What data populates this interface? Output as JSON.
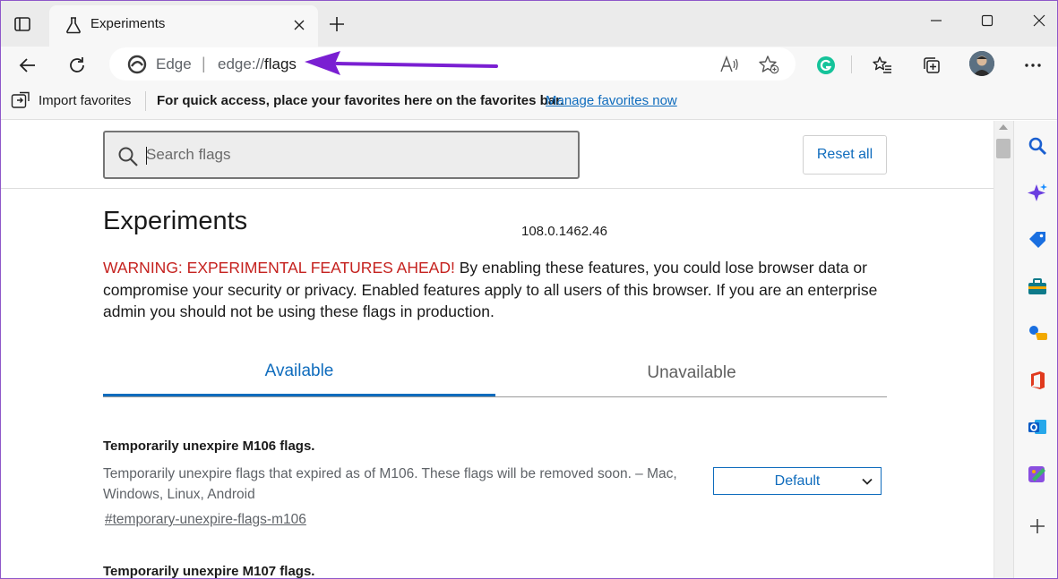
{
  "tab": {
    "title": "Experiments"
  },
  "address": {
    "site_name": "Edge",
    "separator": "|",
    "url_prefix": "edge://",
    "url_path": "flags"
  },
  "favorites_bar": {
    "import_label": "Import favorites",
    "message": "For quick access, place your favorites here on the favorites bar.",
    "manage_link": "Manage favorites now"
  },
  "search": {
    "placeholder": "Search flags",
    "value": ""
  },
  "reset_label": "Reset all",
  "page": {
    "title": "Experiments",
    "version": "108.0.1462.46",
    "warning_label": "WARNING: EXPERIMENTAL FEATURES AHEAD!",
    "warning_text": " By enabling these features, you could lose browser data or compromise your security or privacy. Enabled features apply to all users of this browser. If you are an enterprise admin you should not be using these flags in production."
  },
  "tabs": [
    {
      "label": "Available",
      "active": true
    },
    {
      "label": "Unavailable",
      "active": false
    }
  ],
  "flags": [
    {
      "name": "Temporarily unexpire M106 flags.",
      "description": "Temporarily unexpire flags that expired as of M106. These flags will be removed soon. – Mac, Windows, Linux, Android",
      "link": "#temporary-unexpire-flags-m106",
      "value": "Default"
    },
    {
      "name": "Temporarily unexpire M107 flags."
    }
  ],
  "colors": {
    "accent": "#0f6cbd",
    "warning": "#c5221f",
    "annotation_arrow": "#7a1fd2",
    "grammarly": "#15c39a"
  },
  "icons": {
    "sidebar": [
      "search-icon",
      "copilot-sparkle-icon",
      "shopping-tag-icon",
      "tools-icon",
      "games-icon",
      "office-icon",
      "outlook-icon",
      "designer-icon",
      "add-icon"
    ]
  }
}
